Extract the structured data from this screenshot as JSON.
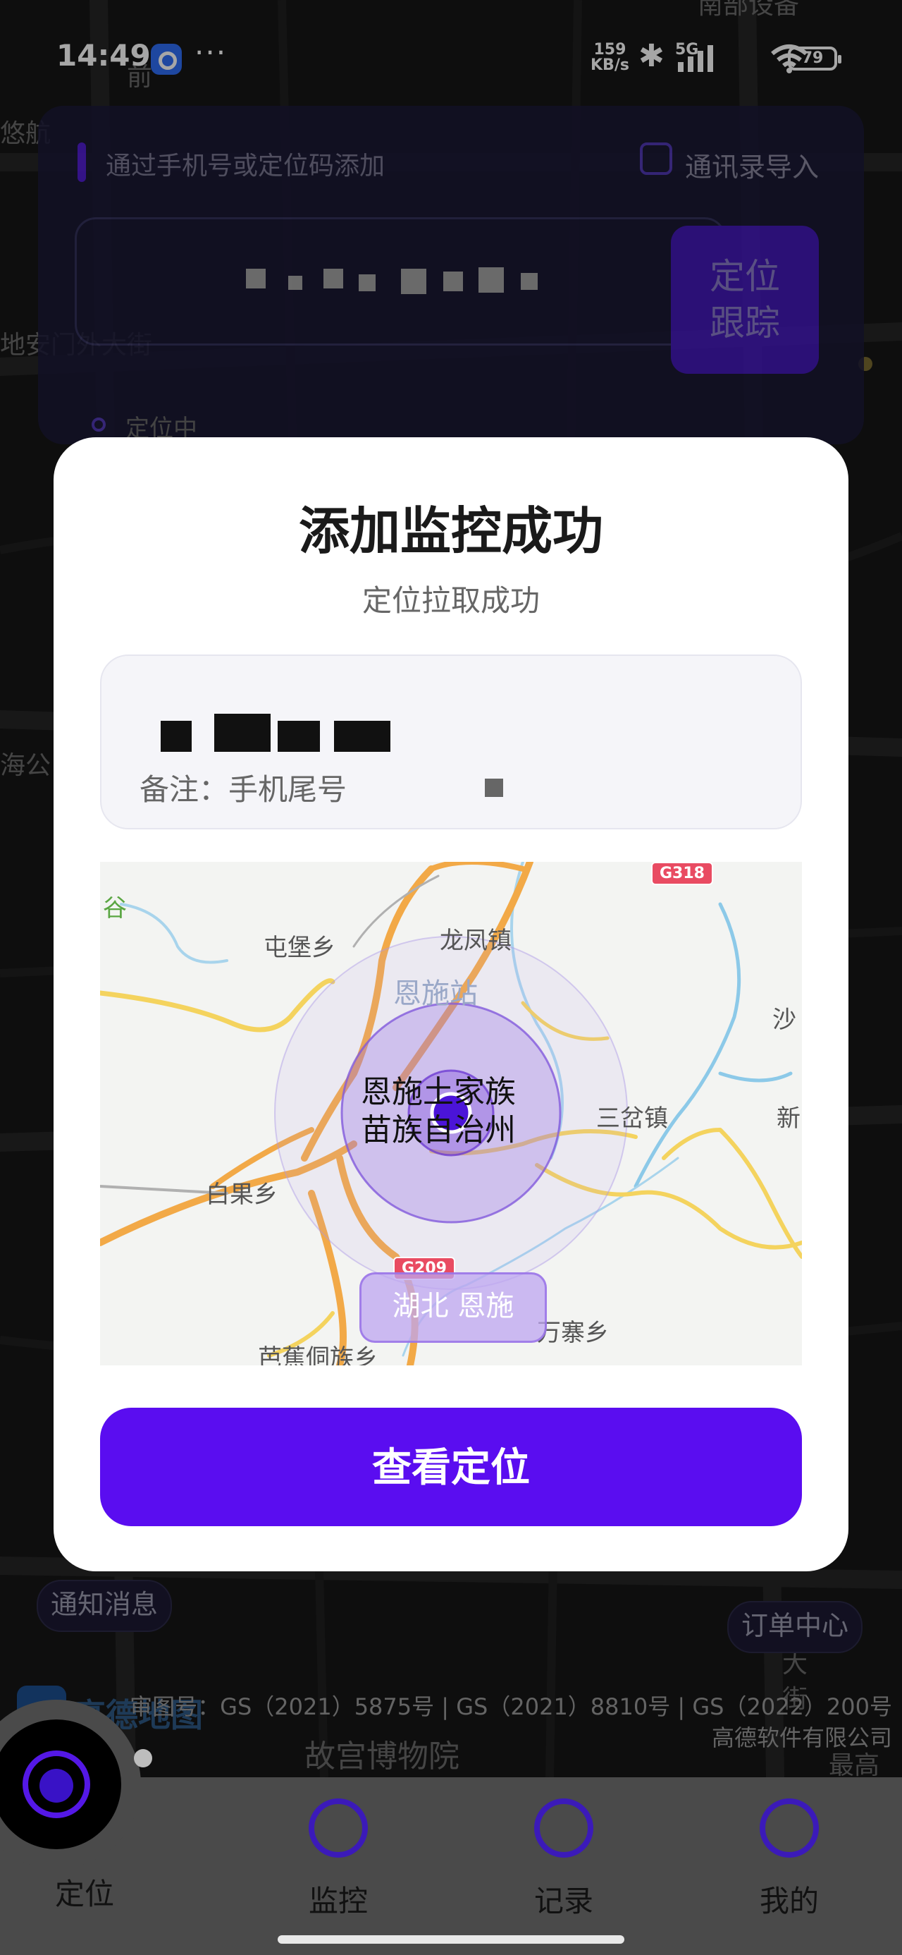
{
  "status_bar": {
    "time": "14:49",
    "more": "···",
    "net_speed_value": "159",
    "net_speed_unit": "KB/s",
    "network_type": "5G",
    "battery": "79",
    "icons": [
      "app-notification-icon",
      "bluetooth-icon",
      "signal-icon",
      "wifi-icon",
      "battery-icon"
    ]
  },
  "background_map": {
    "labels": [
      "南部设备",
      "悠航",
      "前",
      "地安门外大街",
      "海公",
      "故宫博物院",
      "大",
      "街",
      "最高",
      "新",
      "沙"
    ]
  },
  "add_panel": {
    "hint": "通过手机号或定位码添加",
    "import_label": "通讯录导入",
    "track_button": [
      "定位",
      "跟踪"
    ],
    "status": "定位中"
  },
  "modal": {
    "title": "添加监控成功",
    "subtitle": "定位拉取成功",
    "note": "备注：手机尾号",
    "map": {
      "labels": [
        "谷",
        "屯堡乡",
        "龙凤镇",
        "三岔镇",
        "白果乡",
        "万寨乡",
        "芭蕉侗族乡",
        "沙",
        "新"
      ],
      "station": "恩施站",
      "prefecture_line1": "恩施土家族",
      "prefecture_line2": "苗族自治州",
      "road_signs": [
        "G318",
        "G209"
      ],
      "place_badge": "湖北 恩施"
    },
    "button": "查看定位"
  },
  "floating": {
    "notification": "通知消息",
    "order_center": "订单中心",
    "amap_brand": "高德地图",
    "copyright_line1": "审图号：GS（2021）5875号 | GS（2021）8810号 | GS（2022）200号",
    "copyright_line2": "高德软件有限公司",
    "poi": "故宫博物院"
  },
  "bottom_nav": {
    "items": [
      {
        "label": "定位",
        "icon": "location-icon"
      },
      {
        "label": "监控",
        "icon": "monitor-icon"
      },
      {
        "label": "记录",
        "icon": "record-icon"
      },
      {
        "label": "我的",
        "icon": "profile-icon"
      }
    ]
  },
  "colors": {
    "accent": "#5a0df0",
    "panel_bg": "#1c1a3a",
    "nav_bg": "#4a4a4a"
  }
}
